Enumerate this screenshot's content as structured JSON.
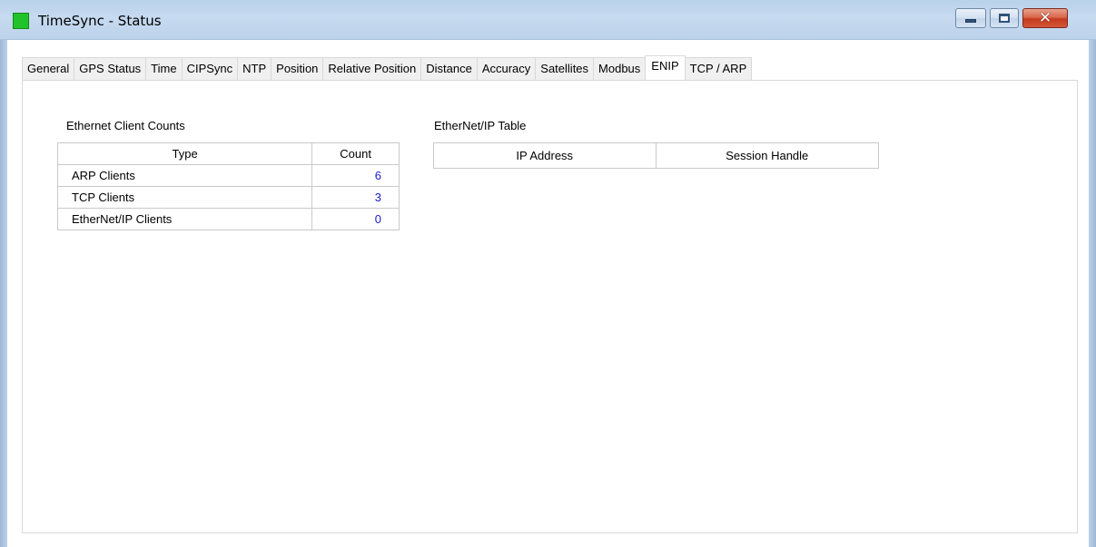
{
  "window": {
    "title": "TimeSync - Status",
    "icon": "green-square-icon",
    "controls": {
      "minimize": "minimize-icon",
      "maximize": "maximize-icon",
      "close": "✕"
    },
    "accent": "#22c32a"
  },
  "tabs": [
    {
      "label": "General",
      "active": false
    },
    {
      "label": "GPS Status",
      "active": false
    },
    {
      "label": "Time",
      "active": false
    },
    {
      "label": "CIPSync",
      "active": false
    },
    {
      "label": "NTP",
      "active": false
    },
    {
      "label": "Position",
      "active": false
    },
    {
      "label": "Relative Position",
      "active": false
    },
    {
      "label": "Distance",
      "active": false
    },
    {
      "label": "Accuracy",
      "active": false
    },
    {
      "label": "Satellites",
      "active": false
    },
    {
      "label": "Modbus",
      "active": false
    },
    {
      "label": "ENIP",
      "active": true
    },
    {
      "label": "TCP / ARP",
      "active": false
    }
  ],
  "client_counts": {
    "title": "Ethernet Client Counts",
    "headers": {
      "type": "Type",
      "count": "Count"
    },
    "rows": [
      {
        "type": "ARP Clients",
        "count": "6"
      },
      {
        "type": "TCP Clients",
        "count": "3"
      },
      {
        "type": "EtherNet/IP Clients",
        "count": "0"
      }
    ],
    "value_color": "#1a1ad0"
  },
  "enip_table": {
    "title": "EtherNet/IP Table",
    "headers": {
      "ip_address": "IP Address",
      "session_handle": "Session Handle"
    },
    "rows": []
  }
}
